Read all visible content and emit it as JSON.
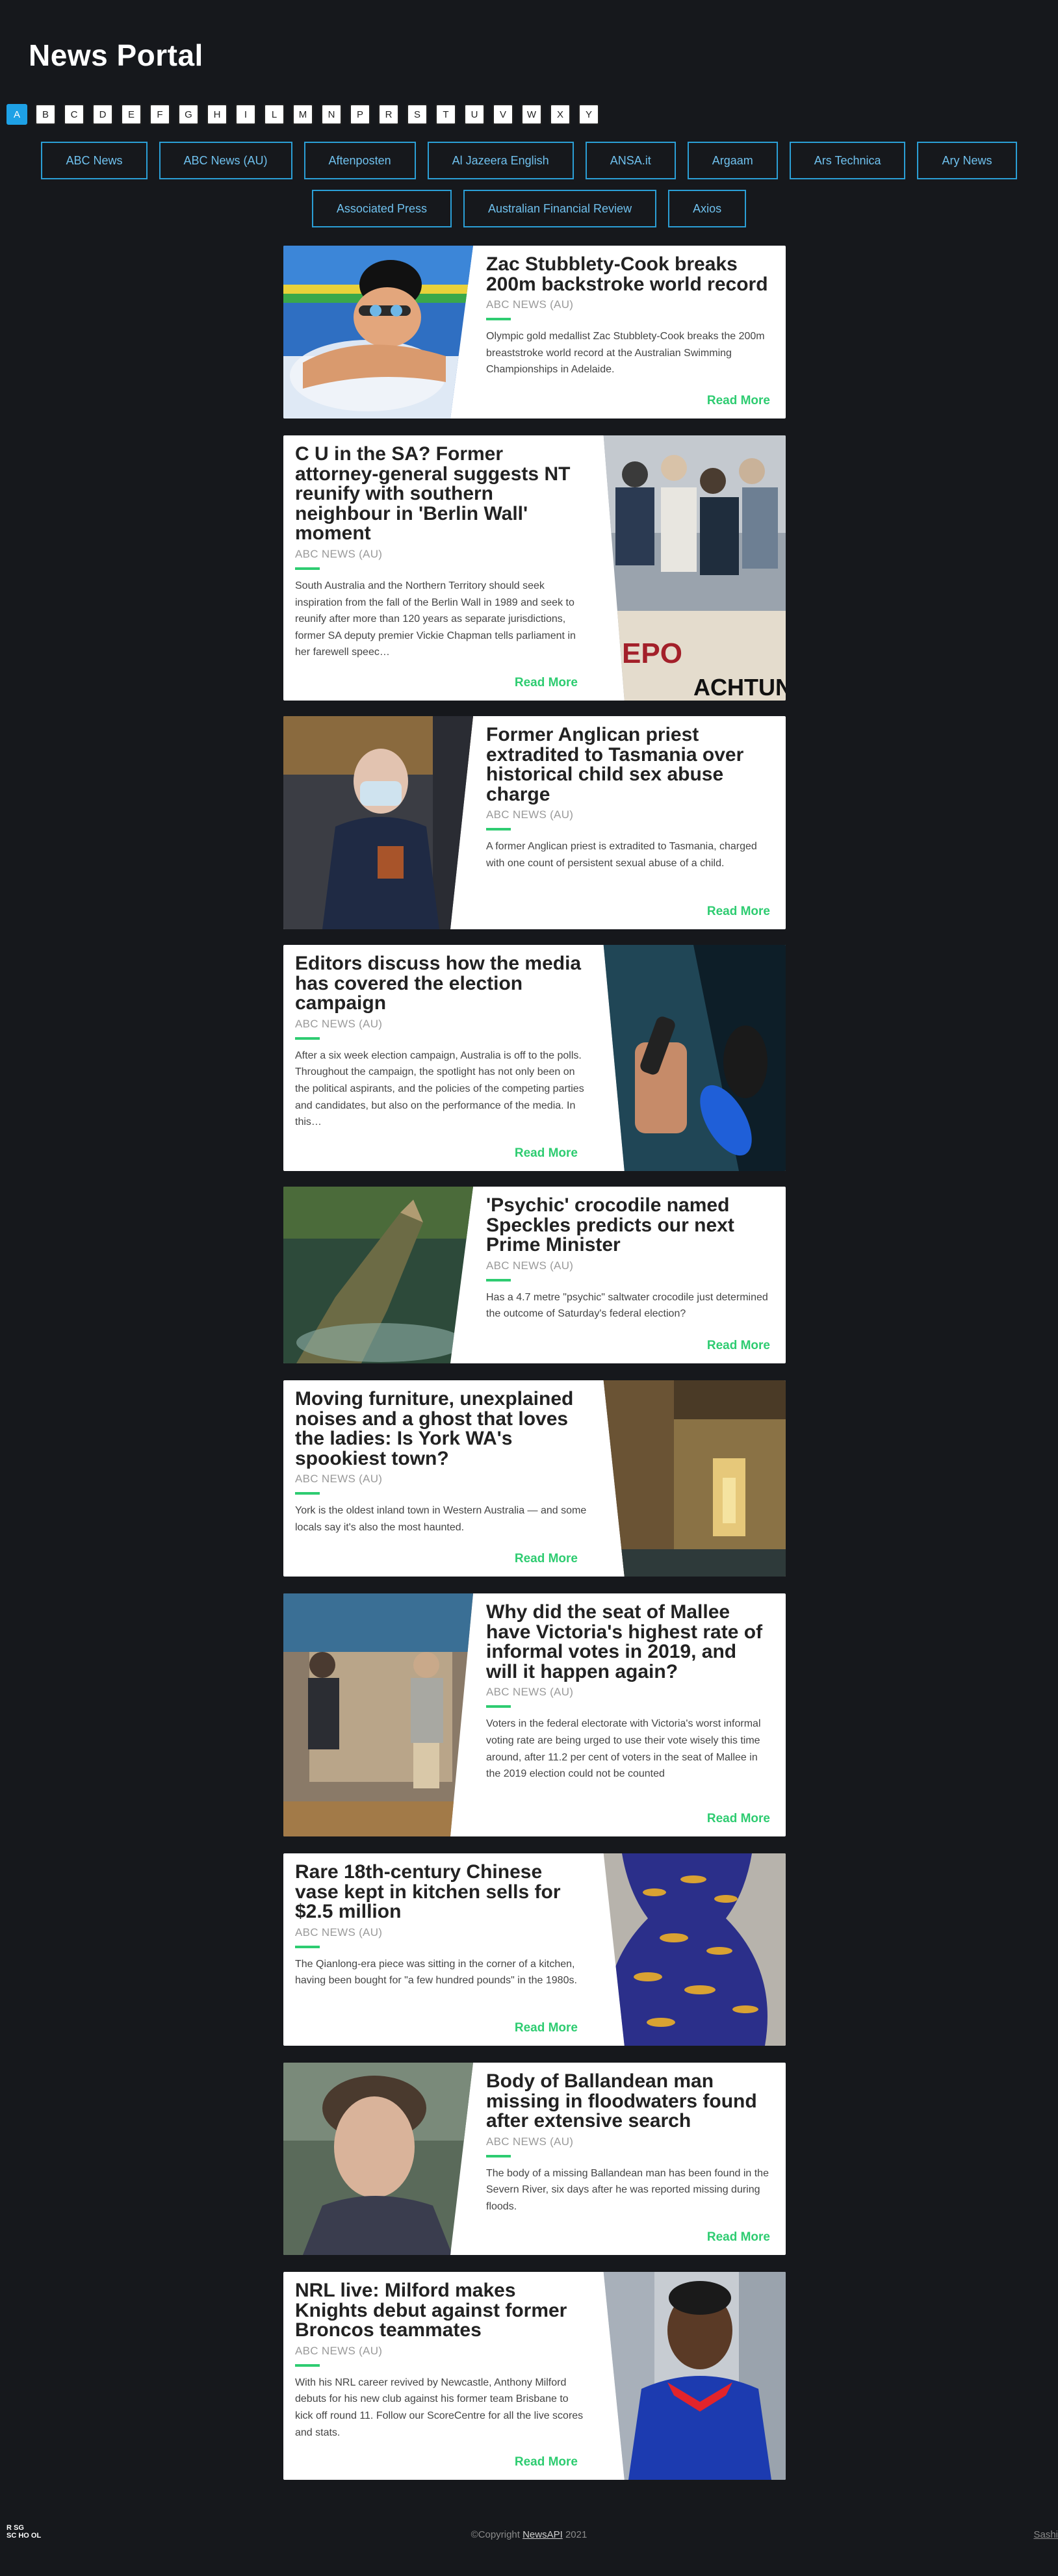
{
  "header": {
    "title": "News Portal"
  },
  "alphabet": {
    "letters": [
      "A",
      "B",
      "C",
      "D",
      "E",
      "F",
      "G",
      "H",
      "I",
      "L",
      "M",
      "N",
      "P",
      "R",
      "S",
      "T",
      "U",
      "V",
      "W",
      "X",
      "Y"
    ],
    "active": "A"
  },
  "sources": {
    "row1": [
      "ABC News",
      "ABC News (AU)",
      "Aftenposten",
      "Al Jazeera English",
      "ANSA.it",
      "Argaam",
      "Ars Technica",
      "Ary News"
    ],
    "row2": [
      "Associated Press",
      "Australian Financial Review",
      "Axios"
    ]
  },
  "articles": [
    {
      "title": "Zac Stubblety-Cook breaks 200m backstroke world record",
      "source": "ABC NEWS (AU)",
      "description": "Olympic gold medallist Zac Stubblety-Cook breaks the 200m breaststroke world record at the Australian Swimming Championships in Adelaide.",
      "read_more": "Read More",
      "image": "swimmer-photo"
    },
    {
      "title": "C U in the SA? Former attorney-general suggests NT reunify with southern neighbour in 'Berlin Wall' moment",
      "source": "ABC NEWS (AU)",
      "description": "South Australia and the Northern Territory should seek inspiration from the fall of the Berlin Wall in 1989 and seek to reunify after more than 120 years as separate jurisdictions, former SA deputy premier Vickie Chapman tells parliament in her farewell speec…",
      "read_more": "Read More",
      "image": "berlin-wall-photo"
    },
    {
      "title": "Former Anglican priest extradited to Tasmania over historical child sex abuse charge",
      "source": "ABC NEWS (AU)",
      "description": "A former Anglican priest is extradited to Tasmania, charged with one count of persistent sexual abuse of a child.",
      "read_more": "Read More",
      "image": "masked-man-photo"
    },
    {
      "title": "Editors discuss how the media has covered the election campaign",
      "source": "ABC NEWS (AU)",
      "description": "After a six week election campaign, Australia is off to the polls. Throughout the campaign, the spotlight has not only been on the political aspirants, and the policies of the competing parties and candidates, but also on the performance of the media. In this…",
      "read_more": "Read More",
      "image": "microphones-photo"
    },
    {
      "title": "'Psychic' crocodile named Speckles predicts our next Prime Minister",
      "source": "ABC NEWS (AU)",
      "description": "Has a 4.7 metre \"psychic\" saltwater crocodile just determined the outcome of Saturday's federal election?",
      "read_more": "Read More",
      "image": "crocodile-photo"
    },
    {
      "title": "Moving furniture, unexplained noises and a ghost that loves the ladies: Is York WA's spookiest town?",
      "source": "ABC NEWS (AU)",
      "description": "York is the oldest inland town in Western Australia — and some locals say it's also the most haunted.",
      "read_more": "Read More",
      "image": "hallway-photo"
    },
    {
      "title": "Why did the seat of Mallee have Victoria's highest rate of informal votes in 2019, and will it happen again?",
      "source": "ABC NEWS (AU)",
      "description": "Voters in the federal electorate with Victoria's worst informal voting rate are being urged to use their vote wisely this time around, after 11.2 per cent of voters in the seat of Mallee in the 2019 election could not be counted",
      "read_more": "Read More",
      "image": "voting-booth-photo"
    },
    {
      "title": "Rare 18th-century Chinese vase kept in kitchen sells for $2.5 million",
      "source": "ABC NEWS (AU)",
      "description": "The Qianlong-era piece was sitting in the corner of a kitchen, having been bought for \"a few hundred pounds\" in the 1980s.",
      "read_more": "Read More",
      "image": "vase-photo"
    },
    {
      "title": "Body of Ballandean man missing in floodwaters found after extensive search",
      "source": "ABC NEWS (AU)",
      "description": "The body of a missing Ballandean man has been found in the Severn River, six days after he was reported missing during floods.",
      "read_more": "Read More",
      "image": "man-portrait-photo"
    },
    {
      "title": "NRL live: Milford makes Knights debut against former Broncos teammates",
      "source": "ABC NEWS (AU)",
      "description": "With his NRL career revived by Newcastle, Anthony Milford debuts for his new club against his former team Brisbane to kick off round 11. Follow our ScoreCentre for all the live scores and stats.",
      "read_more": "Read More",
      "image": "rugby-player-photo"
    }
  ],
  "footer": {
    "logo_line1": "R   SG",
    "logo_line2": "SC HO OL",
    "copyright_prefix": "©Copyright ",
    "copyright_link": "NewsAPI",
    "copyright_suffix": " 2021",
    "author": "Sashi"
  }
}
